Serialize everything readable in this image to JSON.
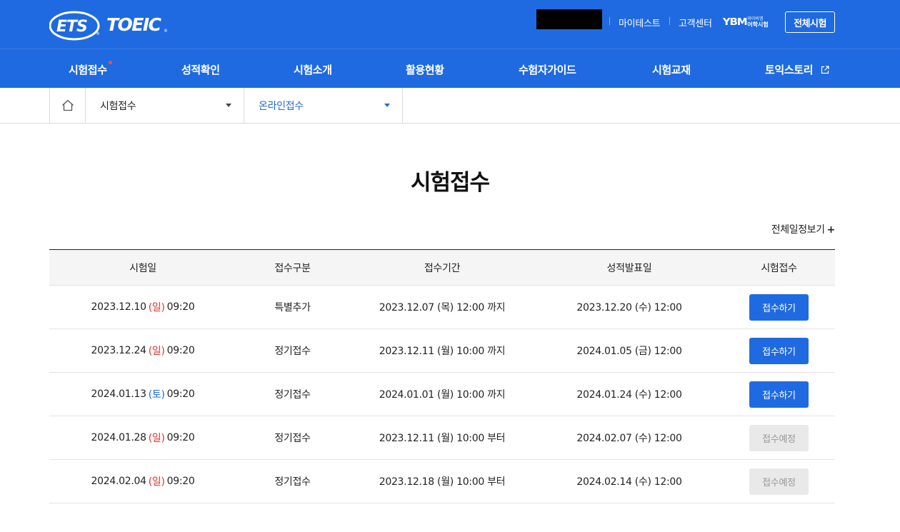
{
  "header": {
    "logo_text": "ETS TOEIC",
    "utility": [
      {
        "label": "마이테스트"
      },
      {
        "label": "고객센터"
      }
    ],
    "ybm_logo": {
      "mark": "YBM",
      "line1": "와이비엠",
      "line2": "어학시험"
    },
    "all_tests_button": "전체시험"
  },
  "gnb": {
    "items": [
      {
        "label": "시험접수",
        "new_dot": true
      },
      {
        "label": "성적확인"
      },
      {
        "label": "시험소개"
      },
      {
        "label": "활용현황"
      },
      {
        "label": "수험자가이드"
      },
      {
        "label": "시험교재"
      },
      {
        "label": "토익스토리",
        "external": true
      }
    ]
  },
  "breadcrumb": {
    "level1": "시험접수",
    "level2": "온라인접수"
  },
  "page": {
    "title": "시험접수",
    "schedule_link": "전체일정보기",
    "schedule_link_symbol": "+"
  },
  "table": {
    "headers": [
      "시험일",
      "접수구분",
      "접수기간",
      "성적발표일",
      "시험접수"
    ],
    "rows": [
      {
        "exam_date": "2023.12.10",
        "exam_day": "(일)",
        "exam_day_type": "sun",
        "exam_time": "09:20",
        "type": "특별추가",
        "period": "2023.12.07 (목) 12:00 까지",
        "result": "2023.12.20 (수) 12:00",
        "action": "접수하기",
        "action_enabled": true
      },
      {
        "exam_date": "2023.12.24",
        "exam_day": "(일)",
        "exam_day_type": "sun",
        "exam_time": "09:20",
        "type": "정기접수",
        "period": "2023.12.11 (월) 10:00 까지",
        "result": "2024.01.05 (금) 12:00",
        "action": "접수하기",
        "action_enabled": true
      },
      {
        "exam_date": "2024.01.13",
        "exam_day": "(토)",
        "exam_day_type": "sat",
        "exam_time": "09:20",
        "type": "정기접수",
        "period": "2024.01.01 (월) 10:00 까지",
        "result": "2024.01.24 (수) 12:00",
        "action": "접수하기",
        "action_enabled": true
      },
      {
        "exam_date": "2024.01.28",
        "exam_day": "(일)",
        "exam_day_type": "sun",
        "exam_time": "09:20",
        "type": "정기접수",
        "period": "2023.12.11 (월) 10:00 부터",
        "result": "2024.02.07 (수) 12:00",
        "action": "접수예정",
        "action_enabled": false
      },
      {
        "exam_date": "2024.02.04",
        "exam_day": "(일)",
        "exam_day_type": "sun",
        "exam_time": "09:20",
        "type": "정기접수",
        "period": "2023.12.18 (월) 10:00 부터",
        "result": "2024.02.14 (수) 12:00",
        "action": "접수예정",
        "action_enabled": false
      }
    ]
  },
  "colors": {
    "brand_blue": "#1f6ae0",
    "sunday_red": "#e0322b",
    "saturday_blue": "#1f6ae0",
    "disabled_bg": "#e9e9e9"
  },
  "icons": {
    "home": "home-icon",
    "caret": "caret-down-icon",
    "external": "external-link-icon"
  }
}
